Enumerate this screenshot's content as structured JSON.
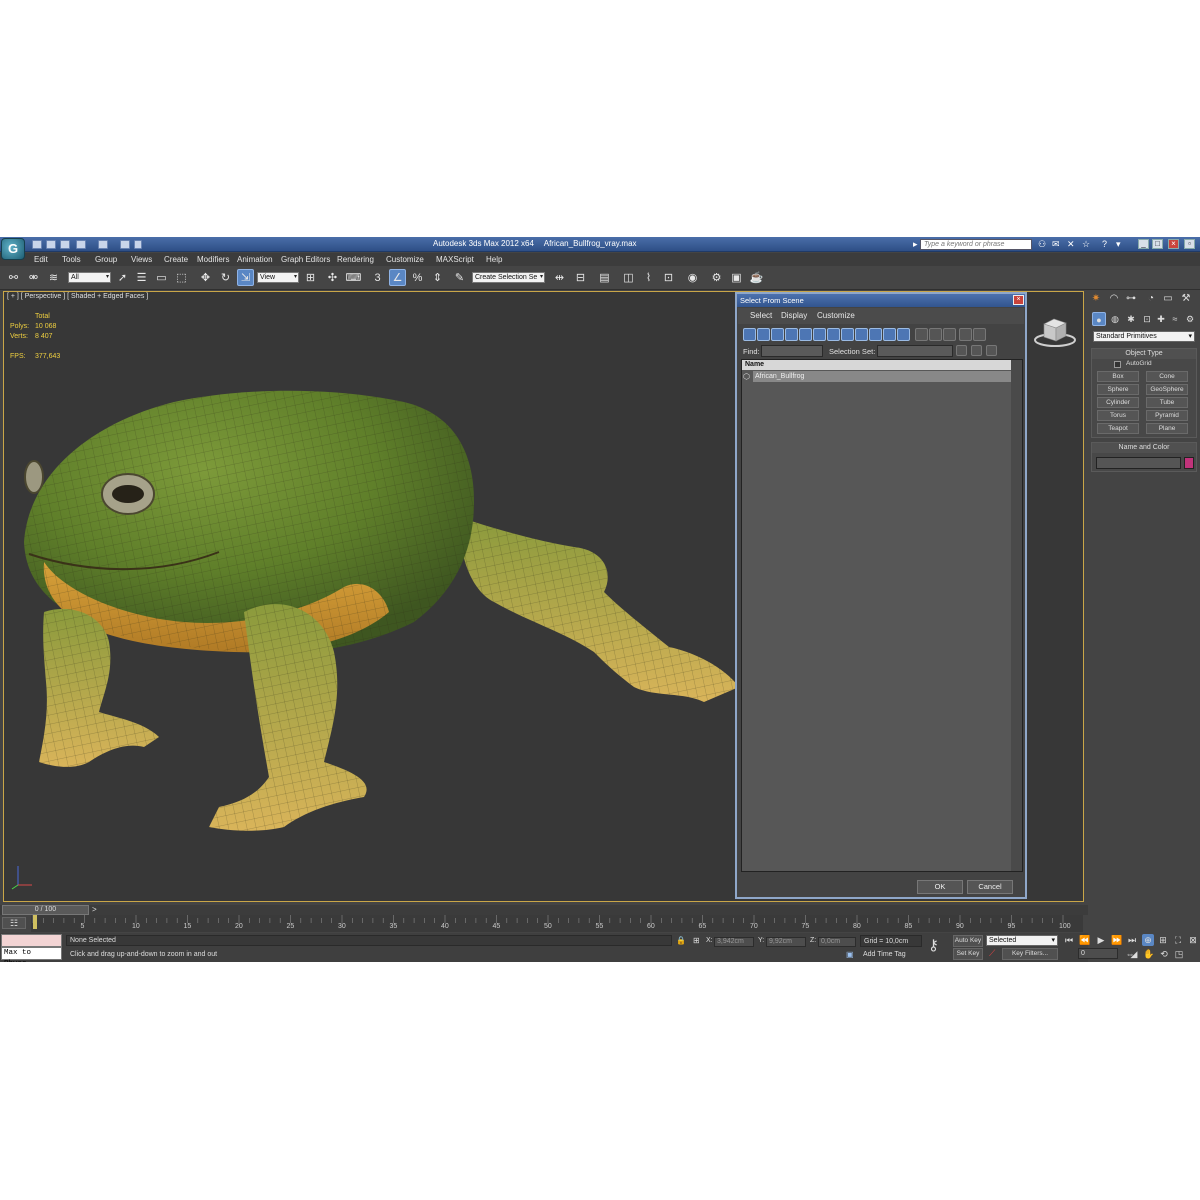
{
  "window": {
    "app_title": "Autodesk 3ds Max  2012 x64",
    "file_name": "African_Bullfrog_vray.max",
    "search_placeholder": "Type a keyword or phrase",
    "logo_glyph": "G"
  },
  "menu": [
    "Edit",
    "Tools",
    "Group",
    "Views",
    "Create",
    "Modifiers",
    "Animation",
    "Graph Editors",
    "Rendering",
    "Customize",
    "MAXScript",
    "Help"
  ],
  "toolbar": {
    "filter_value": "All",
    "ref_coord_value": "View",
    "snap_label": "3",
    "selection_set_value": "Create Selection Se"
  },
  "viewport": {
    "label": "[ + ] [ Perspective ] [ Shaded + Edged Faces ]",
    "stats": {
      "total_label": "Total",
      "polys_label": "Polys:",
      "polys_value": "10 068",
      "verts_label": "Verts:",
      "verts_value": "8 407",
      "fps_label": "FPS:",
      "fps_value": "377,643"
    }
  },
  "dialog": {
    "title": "Select From Scene",
    "menu": [
      "Select",
      "Display",
      "Customize"
    ],
    "find_label": "Find:",
    "selection_set_label": "Selection Set:",
    "column_name": "Name",
    "rows": [
      "African_Bullfrog"
    ],
    "ok_label": "OK",
    "cancel_label": "Cancel"
  },
  "command_panel": {
    "primitives_dropdown": "Standard Primitives",
    "object_type_header": "Object Type",
    "autogrid_label": "AutoGrid",
    "buttons": [
      "Box",
      "Cone",
      "Sphere",
      "GeoSphere",
      "Cylinder",
      "Tube",
      "Torus",
      "Pyramid",
      "Teapot",
      "Plane"
    ],
    "name_color_header": "Name and Color",
    "object_color": "#c0337a"
  },
  "timeline": {
    "slider_label": "0 / 100",
    "ticks": [
      "0",
      "5",
      "10",
      "15",
      "20",
      "25",
      "30",
      "35",
      "40",
      "45",
      "50",
      "55",
      "60",
      "65",
      "70",
      "75",
      "80",
      "85",
      "90",
      "95",
      "100"
    ],
    "frame_value": "0"
  },
  "status": {
    "maxscript_text": "Max to Physc.",
    "selection_text": "None Selected",
    "prompt_text": "Click and drag up-and-down to zoom in and out",
    "x_label": "X:",
    "x_value": "3,942cm",
    "y_label": "Y:",
    "y_value": "9,92cm",
    "z_label": "Z:",
    "z_value": "0,0cm",
    "grid_text": "Grid = 10,0cm",
    "add_time_tag": "Add Time Tag",
    "auto_key": "Auto Key",
    "set_key": "Set Key",
    "key_mode_value": "Selected",
    "key_filters": "Key Filters..."
  },
  "colors": {
    "accent": "#5a87c4",
    "viewport_border": "#c9a648",
    "stats_text": "#f0d040"
  }
}
